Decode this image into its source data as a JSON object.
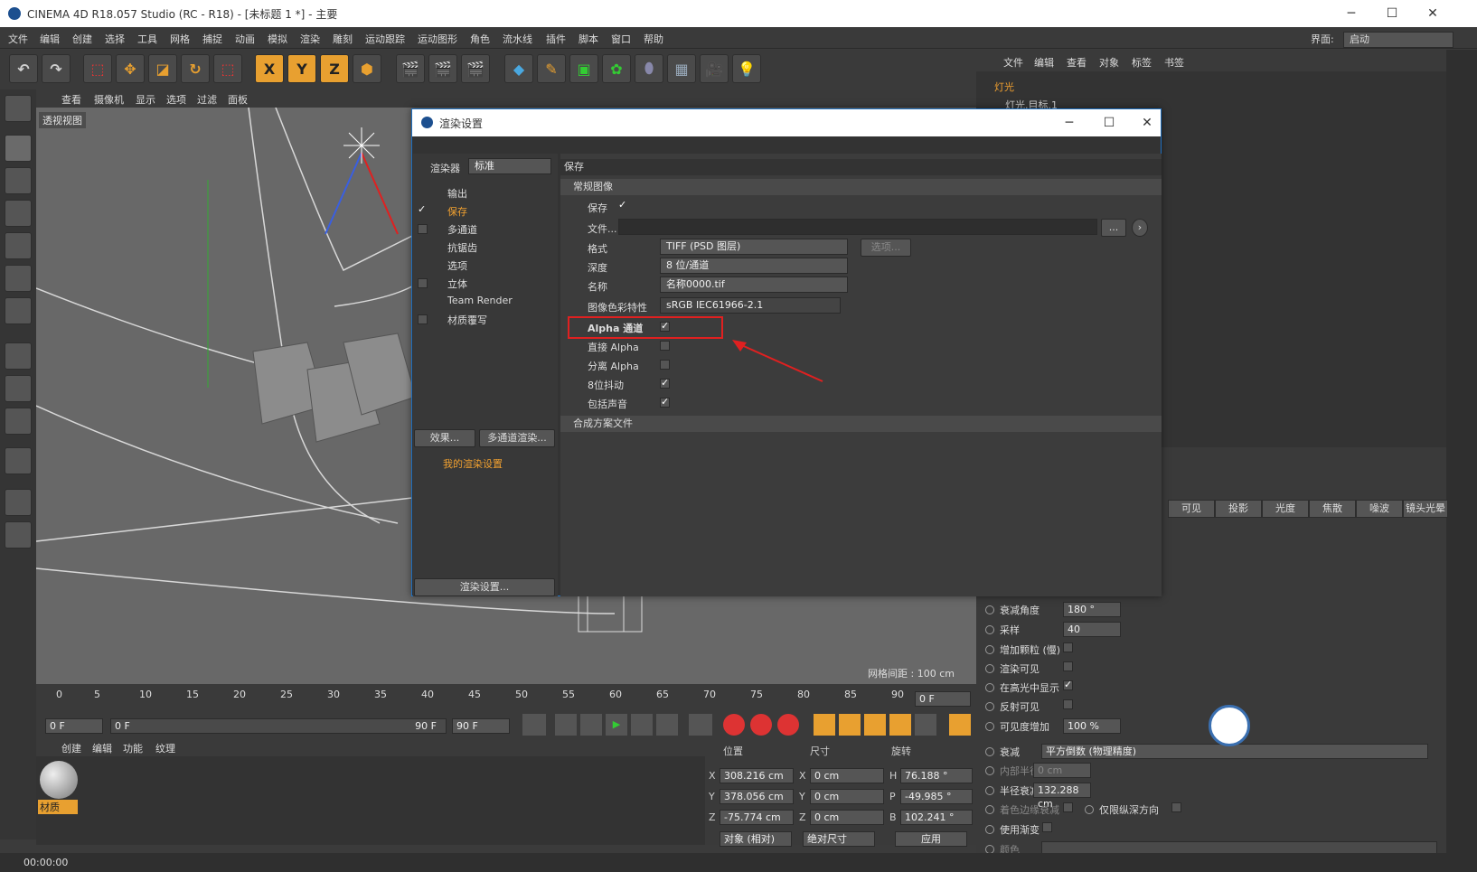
{
  "app": {
    "title": "CINEMA 4D R18.057 Studio (RC - R18) - [未标题 1 *] - 主要"
  },
  "menu": [
    "文件",
    "编辑",
    "创建",
    "选择",
    "工具",
    "网格",
    "捕捉",
    "动画",
    "模拟",
    "渲染",
    "雕刻",
    "运动跟踪",
    "运动图形",
    "角色",
    "流水线",
    "插件",
    "脚本",
    "窗口",
    "帮助"
  ],
  "layout": {
    "label": "界面:",
    "value": "启动"
  },
  "toolbar": {
    "x": "X",
    "y": "Y",
    "z": "Z"
  },
  "viewport": {
    "menu": [
      "查看",
      "摄像机",
      "显示",
      "选项",
      "过滤",
      "面板"
    ],
    "label": "透视视图",
    "grid": "网格间距 : 100 cm"
  },
  "objects": {
    "menu": [
      "文件",
      "编辑",
      "查看",
      "对象",
      "标签",
      "书签"
    ],
    "items": [
      "灯光",
      "灯光.目标.1"
    ]
  },
  "attr": {
    "tabs": [
      "可见",
      "投影",
      "光度",
      "焦散",
      "噪波",
      "镜头光晕"
    ],
    "rows": [
      {
        "label": "衰减角度",
        "value": "180 °"
      },
      {
        "label": "采样",
        "value": "40"
      },
      {
        "label": "增加颗粒 (慢)"
      },
      {
        "label": "渲染可见"
      },
      {
        "label": "在高光中显示"
      },
      {
        "label": "反射可见"
      },
      {
        "label": "可见度增加",
        "value": "100 %"
      }
    ],
    "falloff_label": "衰减",
    "falloff_value": "平方倒数 (物理精度)",
    "inner_radius_label": "内部半径",
    "inner_radius_value": "0 cm",
    "radius_label": "半径衰减",
    "radius_value": "132.288 cm",
    "edge_label": "着色边缘衰减",
    "zonly_label": "仅限纵深方向",
    "gradient_label": "使用渐变",
    "color_label": "颜色"
  },
  "timeline": {
    "ticks": [
      "0",
      "5",
      "10",
      "15",
      "20",
      "25",
      "30",
      "35",
      "40",
      "45",
      "50",
      "55",
      "60",
      "65",
      "70",
      "75",
      "80",
      "85",
      "90"
    ],
    "current": "0 F",
    "start": "0 F",
    "range_start": "0 F",
    "range_end": "90 F",
    "end": "90 F"
  },
  "material": {
    "menu": [
      "创建",
      "编辑",
      "功能",
      "纹理"
    ],
    "name": "材质"
  },
  "coords": {
    "headers": [
      "位置",
      "尺寸",
      "旋转"
    ],
    "rows": [
      {
        "axis": "X",
        "pos": "308.216 cm",
        "size_axis": "X",
        "size": "0 cm",
        "rot_axis": "H",
        "rot": "76.188 °"
      },
      {
        "axis": "Y",
        "pos": "378.056 cm",
        "size_axis": "Y",
        "size": "0 cm",
        "rot_axis": "P",
        "rot": "-49.985 °"
      },
      {
        "axis": "Z",
        "pos": "-75.774 cm",
        "size_axis": "Z",
        "size": "0 cm",
        "rot_axis": "B",
        "rot": "102.241 °"
      }
    ],
    "mode": "对象 (相对)",
    "size_mode": "绝对尺寸",
    "apply": "应用"
  },
  "status": {
    "time": "00:00:00"
  },
  "dialog": {
    "title": "渲染设置",
    "renderer_label": "渲染器",
    "renderer_value": "标准",
    "items": [
      "输出",
      "保存",
      "多通道",
      "抗锯齿",
      "选项",
      "立体",
      "Team Render",
      "材质覆写"
    ],
    "effects_btn": "效果...",
    "multipass_btn": "多通道渲染...",
    "preset": "我的渲染设置",
    "render_settings_btn": "渲染设置...",
    "section": "保存",
    "subsection": "常规图像",
    "save_label": "保存",
    "file_label": "文件...",
    "file_btn": "...",
    "format_label": "格式",
    "format_value": "TIFF (PSD 图层)",
    "options_btn": "选项...",
    "depth_label": "深度",
    "depth_value": "8 位/通道",
    "name_label": "名称",
    "name_value": "名称0000.tif",
    "profile_label": "图像色彩特性",
    "profile_value": "sRGB IEC61966-2.1",
    "alpha_label": "Alpha 通道",
    "straight_label": "直接 Alpha",
    "separate_label": "分离 Alpha",
    "dither_label": "8位抖动",
    "sound_label": "包括声音",
    "compositing": "合成方案文件"
  },
  "colors": {
    "accent": "#f0a030",
    "dialog_border": "#1f6fbf",
    "highlight": "#e02020"
  }
}
